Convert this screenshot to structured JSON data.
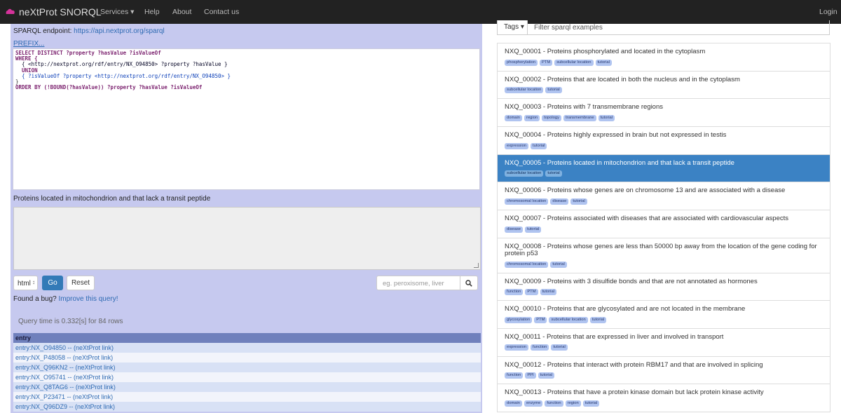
{
  "navbar": {
    "brand": "neXtProt SNORQL",
    "items": [
      "Services ▾",
      "Help",
      "About",
      "Contact us"
    ],
    "login": "Login"
  },
  "left": {
    "endpoint_label": "SPARQL endpoint:",
    "endpoint_url": "https://api.nextprot.org/sparql",
    "prefix_link": "PREFIX...",
    "query_lines": [
      "SELECT DISTINCT ?property ?hasValue ?isValueOf",
      "WHERE {",
      "  { <http://nextprot.org/rdf/entry/NX_O94850> ?property ?hasValue }",
      "  UNION",
      "  { ?isValueOf ?property <http://nextprot.org/rdf/entry/NX_O94850> }",
      "}",
      "ORDER BY (!BOUND(?hasValue)) ?property ?hasValue ?isValueOf"
    ],
    "description": "Proteins located in mitochondrion and that lack a transit peptide",
    "format_select": "html",
    "go_label": "Go",
    "reset_label": "Reset",
    "search_placeholder": "eg. peroxisome, liver",
    "bug_text": "Found a bug?",
    "bug_link": "Improve this query!",
    "query_time": "Query time is 0.332[s] for 84 rows",
    "table_header": "entry",
    "rows": [
      "entry:NX_O94850 -- (neXtProt link)",
      "entry:NX_P48058 -- (neXtProt link)",
      "entry:NX_Q96KN2 -- (neXtProt link)",
      "entry:NX_O95741 -- (neXtProt link)",
      "entry:NX_Q8TAG6 -- (neXtProt link)",
      "entry:NX_P23471 -- (neXtProt link)",
      "entry:NX_Q96DZ9 -- (neXtProt link)"
    ]
  },
  "right": {
    "tags_button": "Tags ▾",
    "filter_placeholder": "Filter sparql examples",
    "items": [
      {
        "title": "NXQ_00001 - Proteins phosphorylated and located in the cytoplasm",
        "tags": [
          "phosphorylation",
          "PTM",
          "subcellular location",
          "tutorial"
        ]
      },
      {
        "title": "NXQ_00002 - Proteins that are located in both the nucleus and in the cytoplasm",
        "tags": [
          "subcellular location",
          "tutorial"
        ]
      },
      {
        "title": "NXQ_00003 - Proteins with 7 transmembrane regions",
        "tags": [
          "domain",
          "region",
          "topology",
          "transmembrane",
          "tutorial"
        ]
      },
      {
        "title": "NXQ_00004 - Proteins highly expressed in brain but not expressed in testis",
        "tags": [
          "expression",
          "tutorial"
        ]
      },
      {
        "title": "NXQ_00005 - Proteins located in mitochondrion and that lack a transit peptide",
        "tags": [
          "subcellular location",
          "tutorial"
        ],
        "active": true
      },
      {
        "title": "NXQ_00006 - Proteins whose genes are on chromosome 13 and are associated with a disease",
        "tags": [
          "chromosomal location",
          "disease",
          "tutorial"
        ]
      },
      {
        "title": "NXQ_00007 - Proteins associated with diseases that are associated with cardiovascular aspects",
        "tags": [
          "disease",
          "tutorial"
        ]
      },
      {
        "title": "NXQ_00008 - Proteins whose genes are less than 50000 bp away from the location of the gene coding for protein p53",
        "tags": [
          "chromosomal location",
          "tutorial"
        ],
        "tall": true
      },
      {
        "title": "NXQ_00009 - Proteins with 3 disulfide bonds and that are not annotated as hormones",
        "tags": [
          "function",
          "PTM",
          "tutorial"
        ]
      },
      {
        "title": "NXQ_00010 - Proteins that are glycosylated and are not located in the membrane",
        "tags": [
          "glycosylation",
          "PTM",
          "subcellular location",
          "tutorial"
        ]
      },
      {
        "title": "NXQ_00011 - Proteins that are expressed in liver and involved in transport",
        "tags": [
          "expression",
          "function",
          "tutorial"
        ]
      },
      {
        "title": "NXQ_00012 - Proteins that interact with protein RBM17 and that are involved in splicing",
        "tags": [
          "function",
          "PPI",
          "tutorial"
        ]
      },
      {
        "title": "NXQ_00013 - Proteins that have a protein kinase domain but lack protein kinase activity",
        "tags": [
          "domain",
          "enzyme",
          "function",
          "region",
          "tutorial"
        ]
      }
    ]
  }
}
